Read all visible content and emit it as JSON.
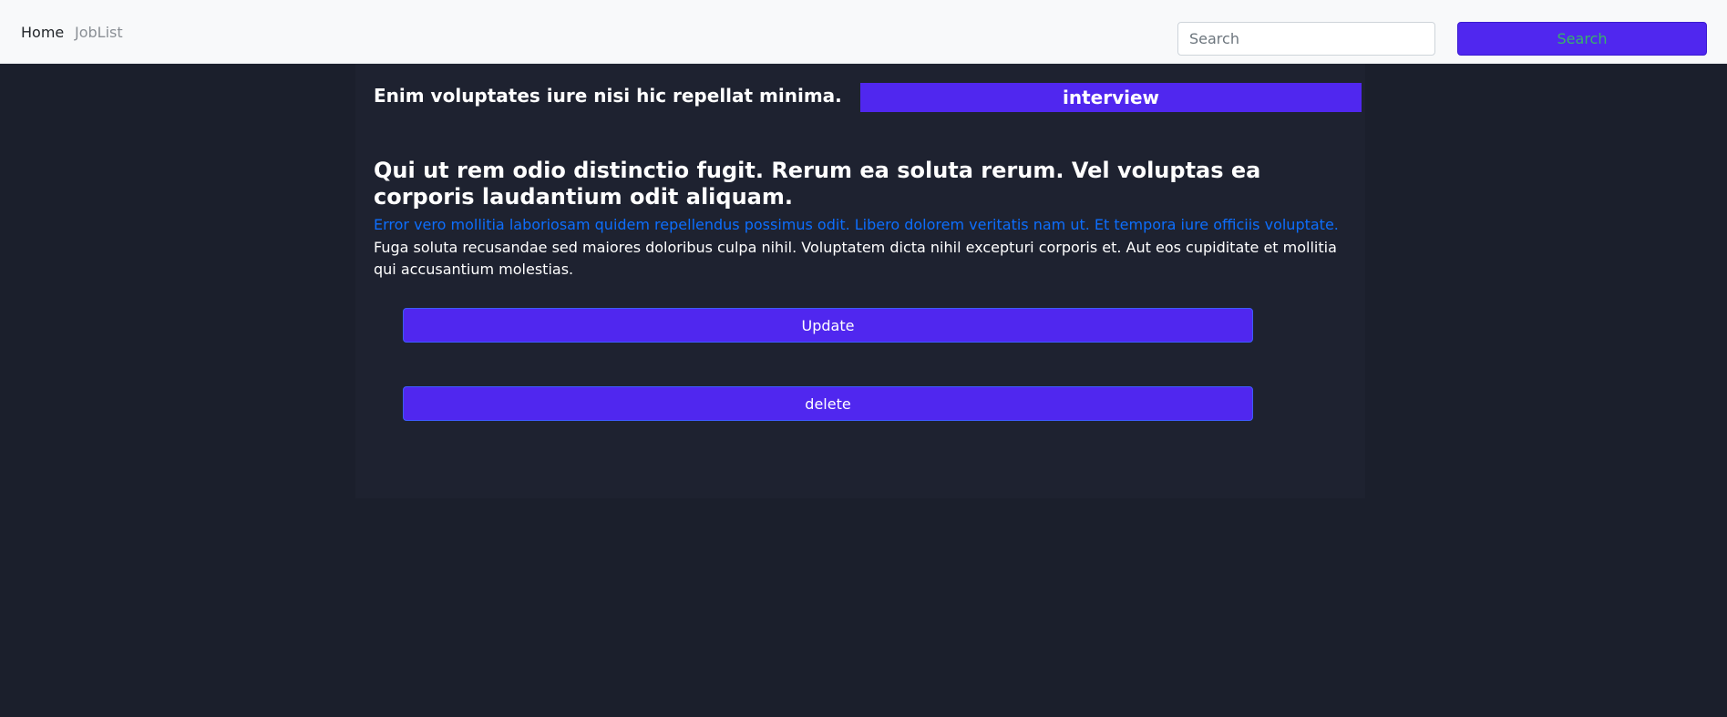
{
  "nav": {
    "home_label": "Home",
    "joblist_label": "JobList",
    "search_placeholder": "Search",
    "search_button_label": "Search"
  },
  "job": {
    "company": "Enim voluptates iure nisi hic repellat minima.",
    "status": "interview",
    "title": "Qui ut rem odio distinctio fugit. Rerum ea soluta rerum. Vel voluptas ea corporis laudantium odit aliquam.",
    "subtitle": "Error vero mollitia laboriosam quidem repellendus possimus odit. Libero dolorem veritatis nam ut. Et tempora iure officiis voluptate.",
    "description": "Fuga soluta recusandae sed maiores doloribus culpa nihil. Voluptatem dicta nihil excepturi corporis et. Aut eos cupiditate et mollitia qui accusantium molestias."
  },
  "actions": {
    "update_label": "Update",
    "delete_label": "delete"
  },
  "colors": {
    "accent": "#5027ef",
    "page_bg": "#1b1f2c",
    "card_bg": "#1e2230",
    "link_blue": "#0d6efd",
    "navbar_bg": "#f8f9fa"
  }
}
